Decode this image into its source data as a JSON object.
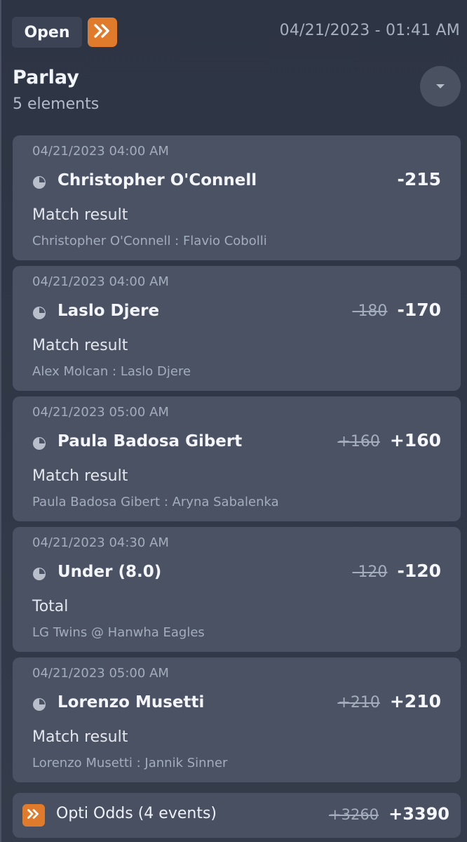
{
  "header": {
    "status_label": "Open",
    "date": "04/21/2023 - 01:41 AM",
    "accent_color": "#e07b2c"
  },
  "parlay": {
    "title": "Parlay",
    "subtitle": "5 elements"
  },
  "bets": [
    {
      "time": "04/21/2023 04:00 AM",
      "selection": "Christopher O'Connell",
      "old_odds": "",
      "odds": "-215",
      "market": "Match result",
      "event": "Christopher O'Connell : Flavio Cobolli"
    },
    {
      "time": "04/21/2023 04:00 AM",
      "selection": "Laslo Djere",
      "old_odds": "-180",
      "odds": "-170",
      "market": "Match result",
      "event": "Alex Molcan : Laslo Djere"
    },
    {
      "time": "04/21/2023 05:00 AM",
      "selection": "Paula Badosa Gibert",
      "old_odds": "+160",
      "odds": "+160",
      "market": "Match result",
      "event": "Paula Badosa Gibert : Aryna Sabalenka"
    },
    {
      "time": "04/21/2023 04:30 AM",
      "selection": "Under (8.0)",
      "old_odds": "-120",
      "odds": "-120",
      "market": "Total",
      "event": "LG Twins @ Hanwha Eagles"
    },
    {
      "time": "04/21/2023 05:00 AM",
      "selection": "Lorenzo Musetti",
      "old_odds": "+210",
      "odds": "+210",
      "market": "Match result",
      "event": "Lorenzo Musetti : Jannik Sinner"
    }
  ],
  "footer": {
    "label": "Opti Odds (4 events)",
    "old_odds": "+3260",
    "odds": "+3390"
  },
  "icons": {
    "header_chevron": "double-chevron-right-icon",
    "collapse": "chevron-down-icon",
    "clock": "clock-icon",
    "footer_chevron": "double-chevron-right-icon"
  }
}
